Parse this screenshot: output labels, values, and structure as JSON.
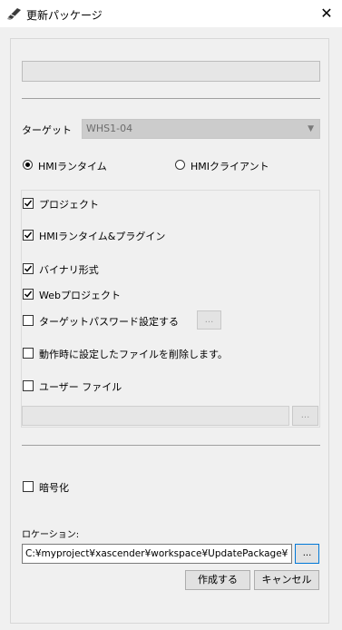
{
  "window": {
    "title": "更新パッケージ",
    "close_glyph": "✕"
  },
  "target": {
    "label": "ターゲット",
    "value": "WHS1-04",
    "arrow": "▼"
  },
  "mode": {
    "runtime_label": "HMIランタイム",
    "client_label": "HMIクライアント",
    "selected": "runtime"
  },
  "options": {
    "project": {
      "label": "プロジェクト",
      "checked": true
    },
    "runtime_plugin": {
      "label": "HMIランタイム&プラグイン",
      "checked": true
    },
    "binary": {
      "label": "バイナリ形式",
      "checked": true
    },
    "web_project": {
      "label": "Webプロジェクト",
      "checked": true
    },
    "target_password": {
      "label": "ターゲットパスワード設定する",
      "checked": false
    },
    "delete_files": {
      "label": "動作時に設定したファイルを削除します。",
      "checked": false
    },
    "user_file": {
      "label": "ユーザー ファイル",
      "checked": false
    }
  },
  "browse_label": "...",
  "encrypt": {
    "label": "暗号化",
    "checked": false
  },
  "location": {
    "label": "ロケーション:",
    "value": "C:¥myproject¥xascender¥workspace¥UpdatePackage¥"
  },
  "buttons": {
    "create": "作成する",
    "cancel": "キャンセル"
  }
}
